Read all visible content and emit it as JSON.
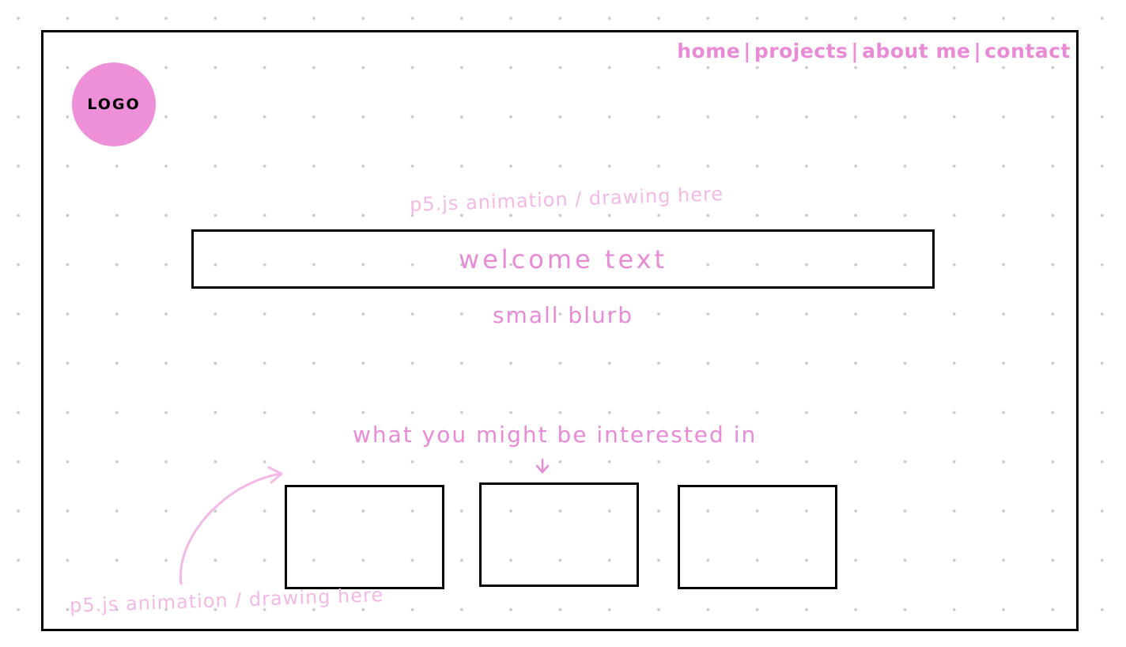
{
  "colors": {
    "accent": "#e98ad6",
    "accent_light": "#f3b8e6",
    "logo_fill": "#ee8fd9",
    "ink": "#000000"
  },
  "nav": {
    "items": [
      "home",
      "projects",
      "about me",
      "contact"
    ],
    "separator": "|"
  },
  "logo": {
    "label": "LOGO"
  },
  "top_note": "p5.js animation / drawing here",
  "welcome": {
    "text": "welcome text"
  },
  "blurb": "small blurb",
  "interest_heading": "what you might be interested in",
  "cards": [
    {
      "label": ""
    },
    {
      "label": ""
    },
    {
      "label": ""
    }
  ],
  "bottom_note": "p5.js animation / drawing here",
  "icons": {
    "down_arrow": "down-arrow-icon",
    "curved_arrow": "curved-arrow-icon"
  }
}
